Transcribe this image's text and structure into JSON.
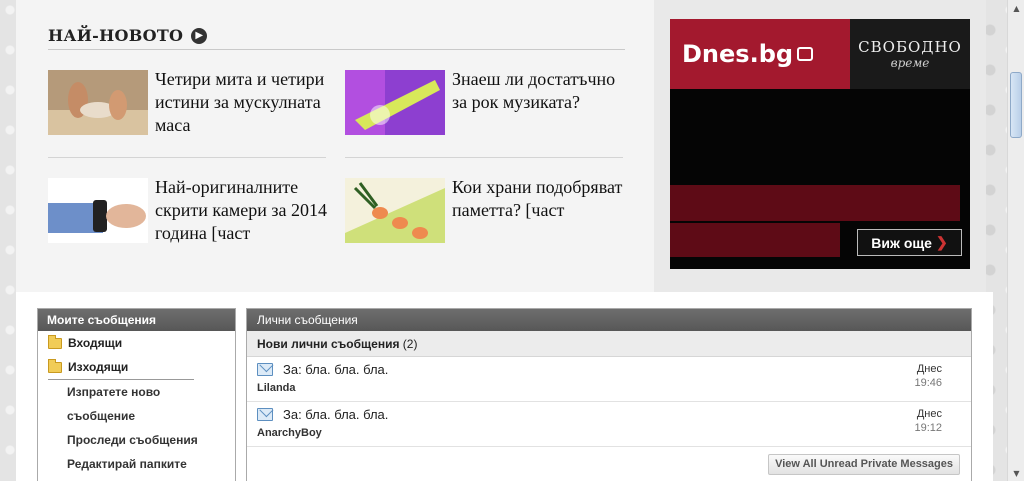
{
  "news": {
    "heading": "НАЙ-НОВОТО",
    "articles": [
      {
        "title": "Четири мита и четири истини за мускулната маса"
      },
      {
        "title": "Знаеш ли достатъчно за рок музиката?"
      },
      {
        "title": "Най-оригиналните скрити камери за 2014 година [част"
      },
      {
        "title": "Кои храни подобряват паметта? [част"
      }
    ]
  },
  "ad": {
    "logo": "Dnes.bg",
    "tagline_top": "СВОБОДНО",
    "tagline_bottom": "време",
    "button": "Виж още",
    "colors": {
      "brand": "#a3192e",
      "dark": "#5e0b16"
    }
  },
  "sidebar": {
    "header": "Моите съобщения",
    "folders": [
      {
        "label": "Входящи",
        "icon": "folder-icon"
      },
      {
        "label": "Изходящи",
        "icon": "folder-icon"
      }
    ],
    "links": [
      {
        "label": "Изпратете ново"
      },
      {
        "label": "съобщение"
      },
      {
        "label": "Проследи съобщения"
      },
      {
        "label": "Редактирай папките"
      }
    ]
  },
  "messages": {
    "header": "Лични съобщения",
    "subheader_label": "Нови лични съобщения",
    "subheader_count": "(2)",
    "items": [
      {
        "subject": "За: бла. бла. бла.",
        "sender": "Lilanda",
        "day": "Днес",
        "time": "19:46"
      },
      {
        "subject": "За: бла. бла. бла.",
        "sender": "AnarchyBoy",
        "day": "Днес",
        "time": "19:12"
      }
    ],
    "view_all": "View All Unread Private Messages"
  }
}
